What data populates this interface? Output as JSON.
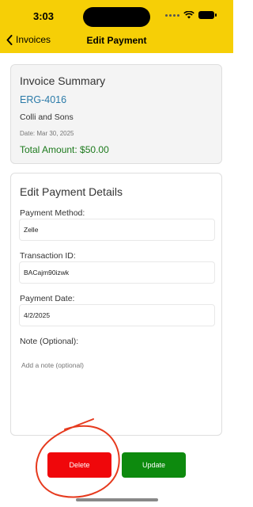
{
  "status": {
    "time": "3:03"
  },
  "nav": {
    "back_label": "Invoices",
    "title": "Edit Payment"
  },
  "summary": {
    "heading": "Invoice Summary",
    "invoice_number": "ERG-4016",
    "client": "Colli and Sons",
    "date": "Date: Mar 30, 2025",
    "total": "Total Amount: $50.00"
  },
  "details": {
    "heading": "Edit Payment Details",
    "method_label": "Payment Method:",
    "method_value": "Zelle",
    "transaction_label": "Transaction ID:",
    "transaction_value": "BACajm90izwk",
    "date_label": "Payment Date:",
    "date_value": "4/2/2025",
    "note_label": "Note (Optional):",
    "note_placeholder": "Add a note (optional)"
  },
  "actions": {
    "delete_label": "Delete",
    "update_label": "Update"
  },
  "colors": {
    "header": "#f6cf06",
    "delete": "#f0070b",
    "update": "#0d8a0e",
    "link": "#2a7aa8",
    "total": "#1d7a1d",
    "annotation": "#e63a1e"
  }
}
